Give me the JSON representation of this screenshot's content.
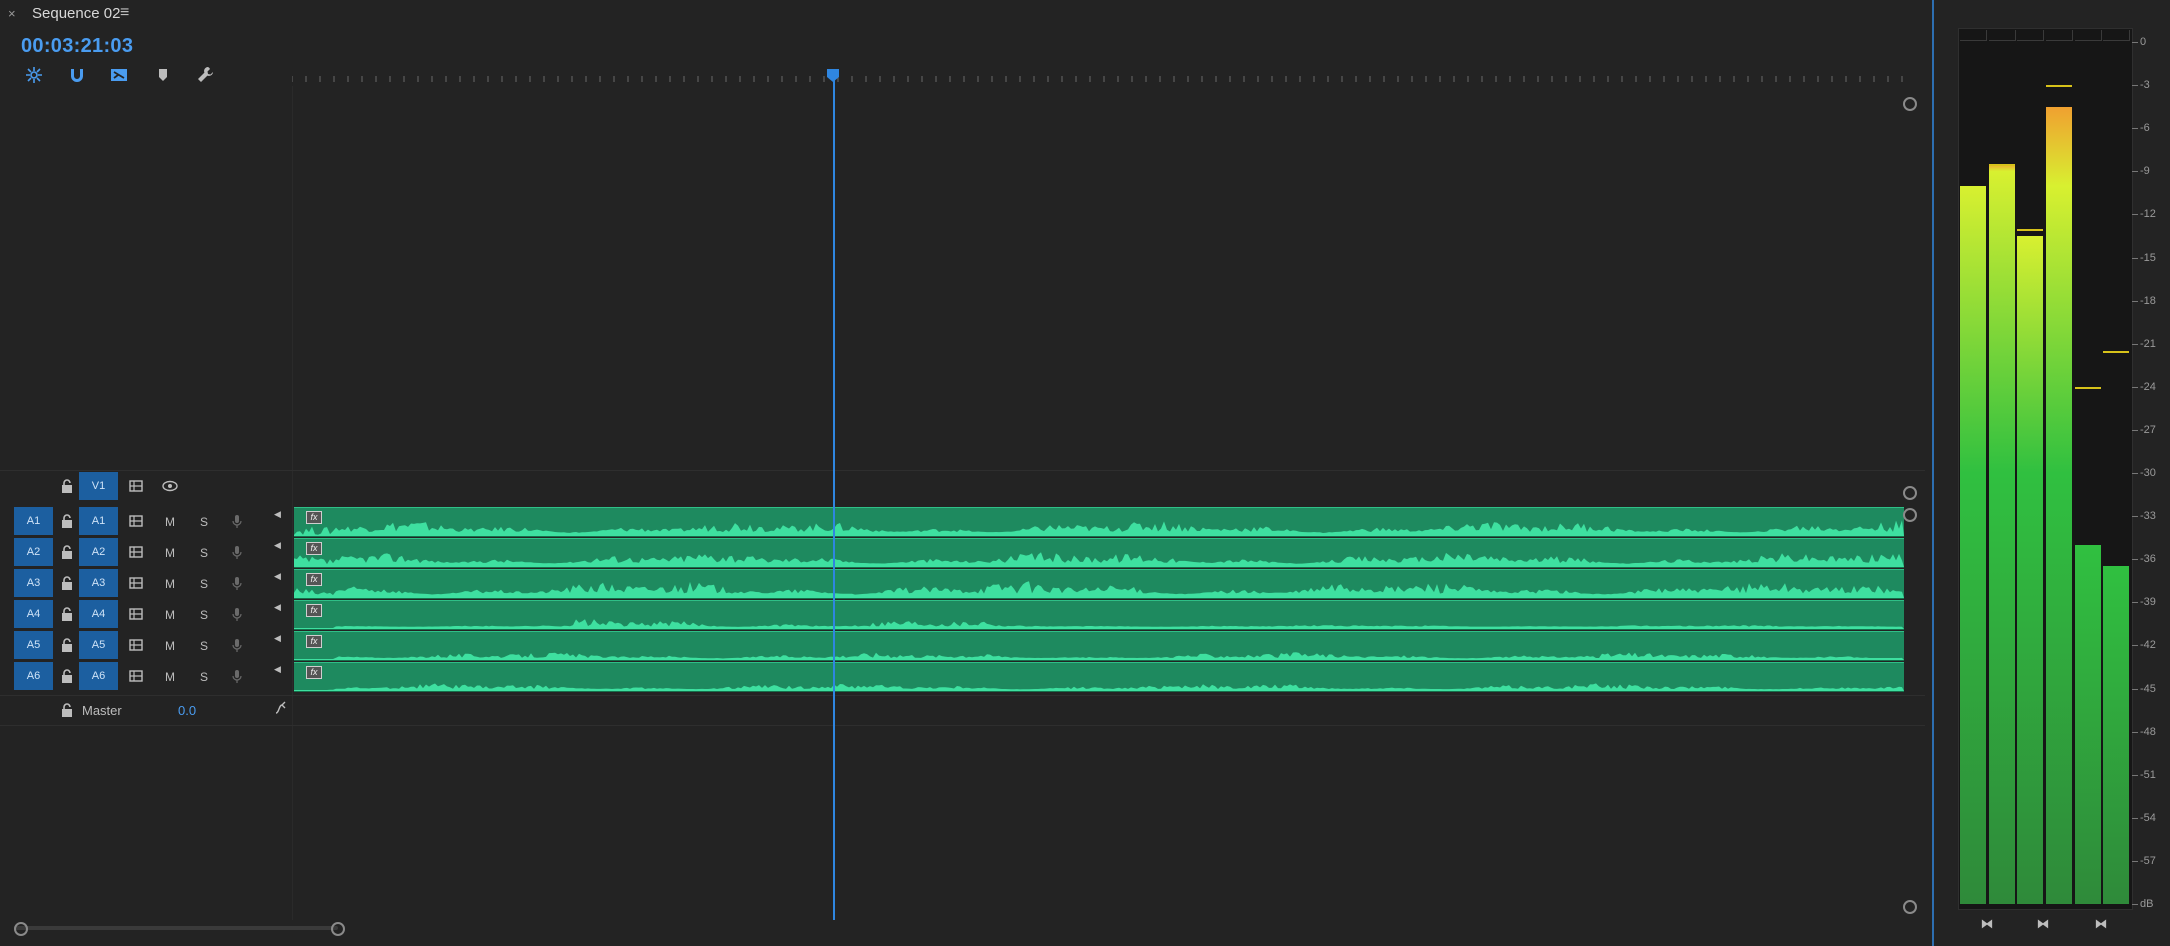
{
  "panel": {
    "close_label": "×",
    "title": "Sequence 02",
    "menu_label": "≡",
    "timecode": "00:03:21:03"
  },
  "tools": [
    {
      "name": "nest-icon"
    },
    {
      "name": "snap-icon"
    },
    {
      "name": "linked-selection-icon"
    },
    {
      "name": "add-marker-icon"
    },
    {
      "name": "settings-wrench-icon"
    }
  ],
  "video_track": {
    "target": "V1"
  },
  "audio_tracks": [
    {
      "source": "A1",
      "target": "A1",
      "mute": "M",
      "solo": "S"
    },
    {
      "source": "A2",
      "target": "A2",
      "mute": "M",
      "solo": "S"
    },
    {
      "source": "A3",
      "target": "A3",
      "mute": "M",
      "solo": "S"
    },
    {
      "source": "A4",
      "target": "A4",
      "mute": "M",
      "solo": "S"
    },
    {
      "source": "A5",
      "target": "A5",
      "mute": "M",
      "solo": "S"
    },
    {
      "source": "A6",
      "target": "A6",
      "mute": "M",
      "solo": "S"
    }
  ],
  "master": {
    "label": "Master",
    "value": "0.0"
  },
  "clip_fx_label": "fx",
  "meters": {
    "scale": [
      "0",
      "-3",
      "-6",
      "-9",
      "-12",
      "-15",
      "-18",
      "-21",
      "-24",
      "-27",
      "-30",
      "-33",
      "-36",
      "-39",
      "-42",
      "-45",
      "-48",
      "-51",
      "-54",
      "-57",
      "dB"
    ],
    "levels_db": [
      -10,
      -8.5,
      -13.5,
      -4.5,
      -35,
      -36.5
    ],
    "peaks_db": [
      null,
      -8.5,
      -13,
      -3,
      -24,
      -21.5
    ],
    "colors": {
      "top": "#f0a030",
      "mid": "#d8f030",
      "green": "#30c040",
      "bottom": "#2f8a3a",
      "peak": "#d7c21a"
    }
  },
  "colors": {
    "accent": "#4a9cf0",
    "clip": "#1e8a5f",
    "waveform": "#3ee0a0",
    "target": "#1c5fa0"
  }
}
